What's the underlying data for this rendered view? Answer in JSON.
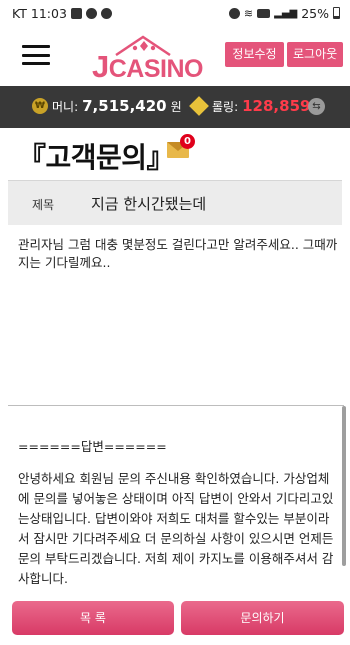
{
  "status_bar": {
    "carrier": "KT",
    "time": "11:03",
    "battery": "25%",
    "icons": [
      "photo-icon",
      "message-icon",
      "messenger-icon",
      "alarm-icon",
      "wifi-icon",
      "hd-icon",
      "signal-icon",
      "battery-icon"
    ]
  },
  "header": {
    "logo_j": "J",
    "logo_text": "CASINO",
    "profile_button": "정보수정",
    "logout_button": "로그아웃"
  },
  "balance": {
    "money_label": "머니:",
    "money_value": "7,515,420",
    "money_unit": "원",
    "rolling_label": "롤링:",
    "rolling_value": "128,859",
    "rolling_unit": "P",
    "coin_glyph": "₩"
  },
  "page": {
    "title": "『고객문의』",
    "mail_badge": "0"
  },
  "subject": {
    "label": "제목",
    "value": "지금 한시간됐는데"
  },
  "message": "관리자님 그럼 대충 몇분정도 걸린다고만 알려주세요.. 그때까지는 기다릴께요..",
  "answer": {
    "header": "======답변======",
    "body": "안녕하세요 회원님 문의 주신내용 확인하였습니다. 가상업체에 문의를 넣어놓은 상태이며 아직 답변이 안와서 기다리고있는상태입니다. 답변이와야 저희도 대처를 할수있는 부분이라서 잠시만 기다려주세요 더 문의하실 사항이 있으시면 언제든 문의 부탁드리겠습니다. 저희 제이 카지노를 이용해주셔서 감사합니다."
  },
  "buttons": {
    "list": "목 록",
    "inquiry": "문의하기"
  },
  "colors": {
    "brand_pink": "#e4547a",
    "balance_bar": "#383838",
    "rolling_red": "#ff3b4a"
  }
}
